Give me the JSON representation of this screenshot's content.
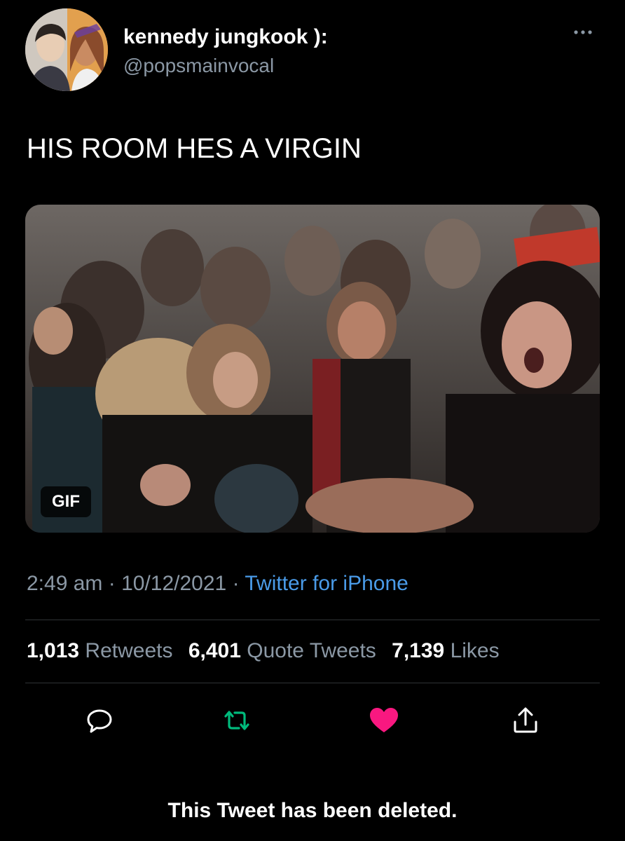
{
  "author": {
    "display_name": "kennedy jungkook ):",
    "handle": "@popsmainvocal"
  },
  "tweet": {
    "text": "HIS ROOM HES A VIRGIN",
    "media_badge": "GIF"
  },
  "meta": {
    "time": "2:49 am",
    "separator": "·",
    "date": "10/12/2021",
    "source": "Twitter for iPhone"
  },
  "stats": {
    "retweets_count": "1,013",
    "retweets_label": "Retweets",
    "quotes_count": "6,401",
    "quotes_label": "Quote Tweets",
    "likes_count": "7,139",
    "likes_label": "Likes"
  },
  "actions": {
    "reply_icon": "reply-icon",
    "retweet_icon": "retweet-icon",
    "like_icon": "heart-icon",
    "share_icon": "share-icon",
    "liked": true
  },
  "footer": {
    "notice": "This Tweet has been deleted."
  },
  "colors": {
    "background": "#000000",
    "text_primary": "#ffffff",
    "text_secondary": "#8b98a5",
    "link": "#4a9be8",
    "retweet_green": "#00ba7c",
    "like_pink": "#f91880",
    "divider": "#2f3336"
  }
}
